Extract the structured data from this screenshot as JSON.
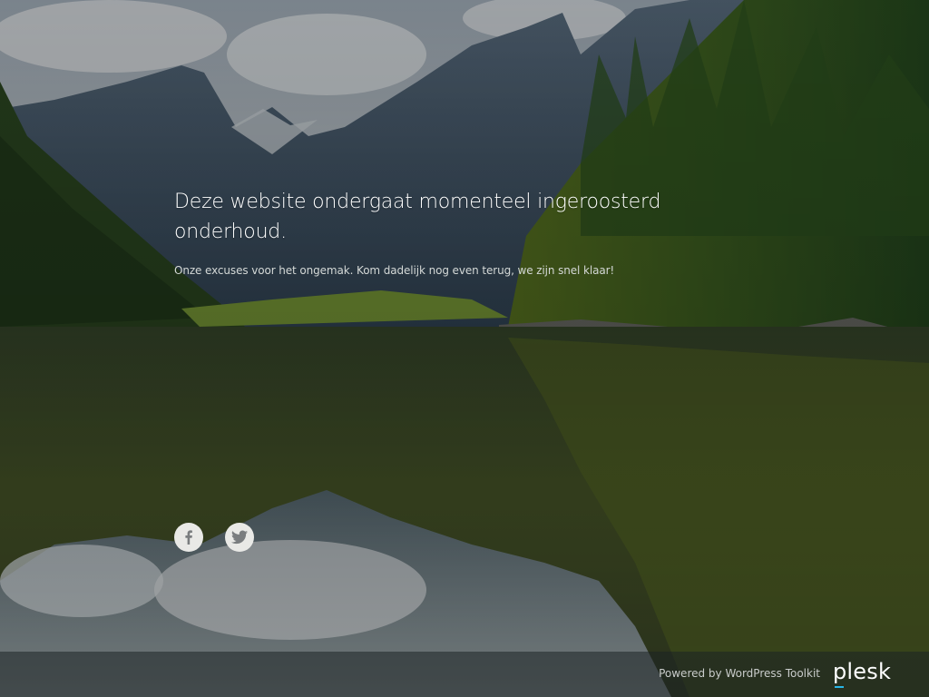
{
  "page": {
    "headline": "Deze website ondergaat momenteel ingeroosterd onderhoud.",
    "subline": "Onze excuses voor het ongemak. Kom dadelijk nog even terug, we zijn snel klaar!"
  },
  "social": [
    {
      "name": "facebook",
      "icon": "facebook-icon"
    },
    {
      "name": "twitter",
      "icon": "twitter-icon"
    }
  ],
  "footer": {
    "powered_by": "Powered by WordPress Toolkit",
    "logo_text": "plesk"
  },
  "colors": {
    "overlay": "#1c2224",
    "text": "#ffffff",
    "icon_bg": "#e9e9e6",
    "plesk_accent": "#28b6e8"
  }
}
